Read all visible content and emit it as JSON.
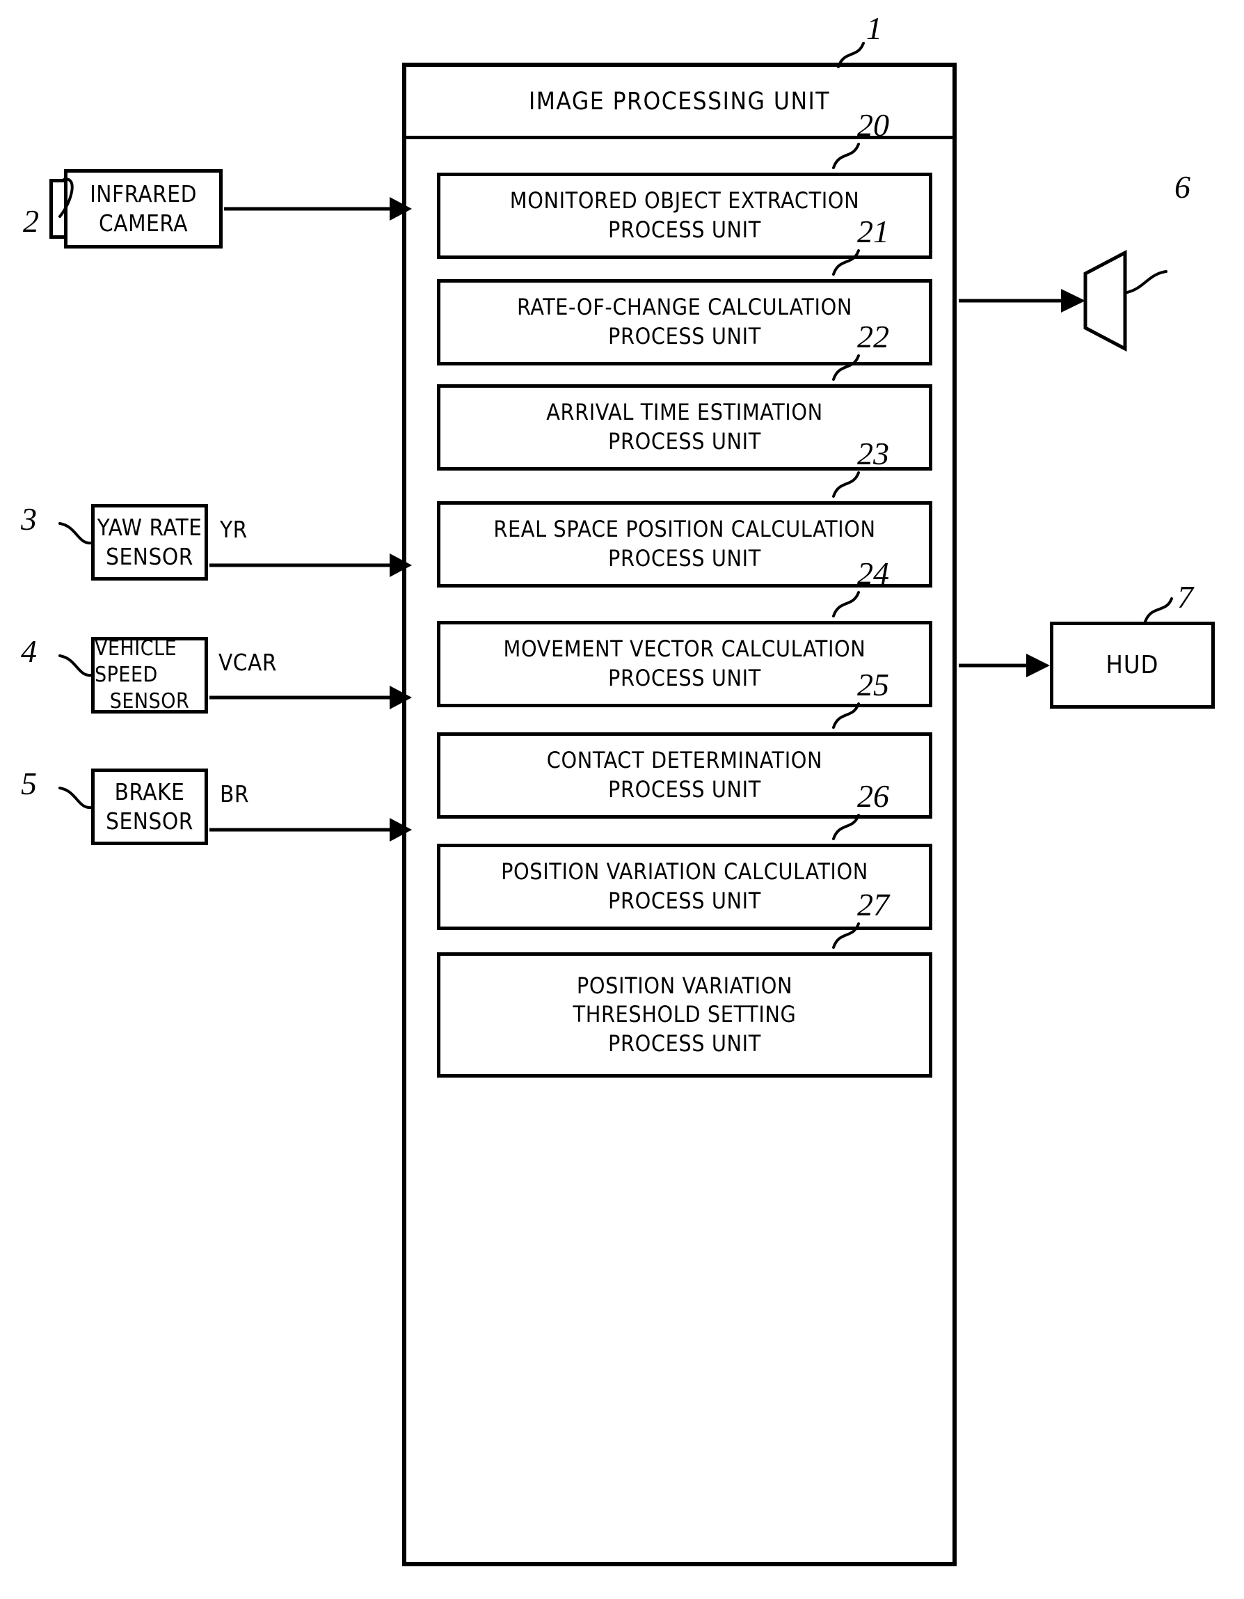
{
  "figure": {
    "main_unit": {
      "title": "IMAGE PROCESSING UNIT",
      "ref": "1"
    },
    "process_units": [
      {
        "ref": "20",
        "lines": [
          "MONITORED  OBJECT  EXTRACTION",
          "PROCESS  UNIT"
        ]
      },
      {
        "ref": "21",
        "lines": [
          "RATE-OF-CHANGE  CALCULATION",
          "PROCESS  UNIT"
        ]
      },
      {
        "ref": "22",
        "lines": [
          "ARRIVAL  TIME  ESTIMATION",
          "PROCESS  UNIT"
        ]
      },
      {
        "ref": "23",
        "lines": [
          "REAL SPACE POSITION CALCULATION",
          "PROCESS  UNIT"
        ]
      },
      {
        "ref": "24",
        "lines": [
          "MOVEMENT  VECTOR  CALCULATION",
          "PROCESS  UNIT"
        ]
      },
      {
        "ref": "25",
        "lines": [
          "CONTACT  DETERMINATION",
          "PROCESS  UNIT"
        ]
      },
      {
        "ref": "26",
        "lines": [
          "POSITION VARIATION CALCULATION",
          "PROCESS  UNIT"
        ]
      },
      {
        "ref": "27",
        "lines": [
          "POSITION  VARIATION",
          "THRESHOLD  SETTING",
          "PROCESS  UNIT"
        ]
      }
    ],
    "inputs": [
      {
        "ref": "2",
        "lines": [
          "INFRARED",
          "CAMERA"
        ],
        "signal": ""
      },
      {
        "ref": "3",
        "lines": [
          "YAW  RATE",
          "SENSOR"
        ],
        "signal": "YR"
      },
      {
        "ref": "4",
        "lines": [
          "VEHICLE SPEED",
          "SENSOR"
        ],
        "signal": "VCAR"
      },
      {
        "ref": "5",
        "lines": [
          "BRAKE",
          "SENSOR"
        ],
        "signal": "BR"
      }
    ],
    "outputs": [
      {
        "ref": "6",
        "label": "",
        "icon": "speaker-icon"
      },
      {
        "ref": "7",
        "label": "HUD",
        "icon": ""
      }
    ],
    "colors": {
      "ink": "#000000",
      "paper": "#ffffff"
    }
  }
}
